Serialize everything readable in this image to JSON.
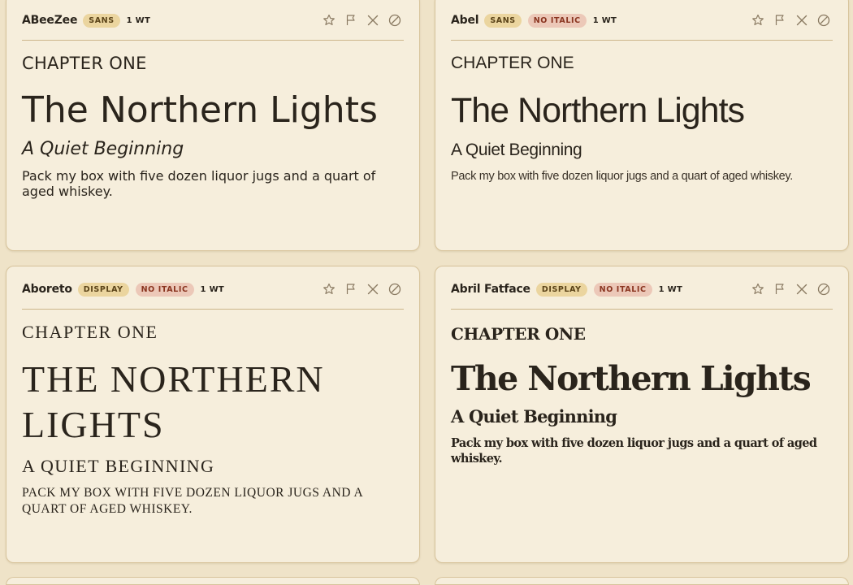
{
  "cards": [
    {
      "name": "ABeeZee",
      "badges": [
        "SANS"
      ],
      "weights": "1 WT",
      "heading": "CHAPTER ONE",
      "title": "The Northern Lights",
      "subtitle": "A Quiet Beginning",
      "body": "Pack my box with five dozen liquor jugs and a quart of aged whiskey."
    },
    {
      "name": "Abel",
      "badges": [
        "SANS",
        "NO ITALIC"
      ],
      "weights": "1 WT",
      "heading": "CHAPTER ONE",
      "title": "The Northern Lights",
      "subtitle": "A Quiet Beginning",
      "body": "Pack my box with five dozen liquor jugs and a quart of aged whiskey."
    },
    {
      "name": "Aboreto",
      "badges": [
        "DISPLAY",
        "NO ITALIC"
      ],
      "weights": "1 WT",
      "heading": "CHAPTER ONE",
      "title": "The Northern Lights",
      "subtitle": "A Quiet Beginning",
      "body": "Pack my box with five dozen liquor jugs and a quart of aged whiskey."
    },
    {
      "name": "Abril Fatface",
      "badges": [
        "DISPLAY",
        "NO ITALIC"
      ],
      "weights": "1 WT",
      "heading": "CHAPTER ONE",
      "title": "The Northern Lights",
      "subtitle": "A Quiet Beginning",
      "body": "Pack my box with five dozen liquor jugs and a quart of aged whiskey."
    }
  ],
  "card_icons": [
    "star-icon",
    "flag-icon",
    "close-icon",
    "block-icon"
  ],
  "colors": {
    "background": "#efe3c8",
    "card": "#f6eedc",
    "badge_category": "#ebd59f",
    "badge_no_italic": "#ecc8b8",
    "badge_no_italic_text": "#8a3520",
    "text": "#2a241c"
  }
}
